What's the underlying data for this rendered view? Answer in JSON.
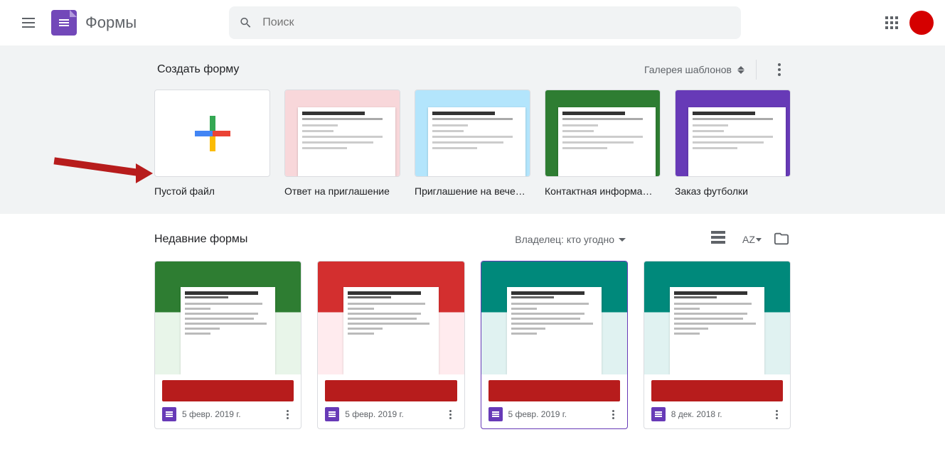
{
  "header": {
    "app_title": "Формы",
    "search_placeholder": "Поиск"
  },
  "templates": {
    "title": "Создать форму",
    "gallery_label": "Галерея шаблонов",
    "items": [
      {
        "label": "Пустой файл",
        "kind": "blank"
      },
      {
        "label": "Ответ на приглашение",
        "bg": "#f8d7da",
        "img_hint": "photo"
      },
      {
        "label": "Приглашение на вече…",
        "bg": "#b3e5fc"
      },
      {
        "label": "Контактная информа…",
        "bg": "#2e7d32"
      },
      {
        "label": "Заказ футболки",
        "bg": "#673ab7"
      }
    ]
  },
  "recent": {
    "title": "Недавние формы",
    "owner_filter": "Владелец: кто угодно",
    "forms": [
      {
        "date": "5 февр. 2019 г.",
        "bg": "#2e7d32",
        "doc_bg": "#e8f5e9",
        "selected": false
      },
      {
        "date": "5 февр. 2019 г.",
        "bg": "#d32f2f",
        "doc_bg": "#ffebee",
        "selected": false
      },
      {
        "date": "5 февр. 2019 г.",
        "bg": "#00897b",
        "doc_bg": "#e0f2f1",
        "selected": true
      },
      {
        "date": "8 дек. 2018 г.",
        "bg": "#00897b",
        "doc_bg": "#e0f2f1",
        "selected": false
      }
    ]
  },
  "colors": {
    "brand": "#673ab7",
    "redaction": "#b71c1c"
  }
}
